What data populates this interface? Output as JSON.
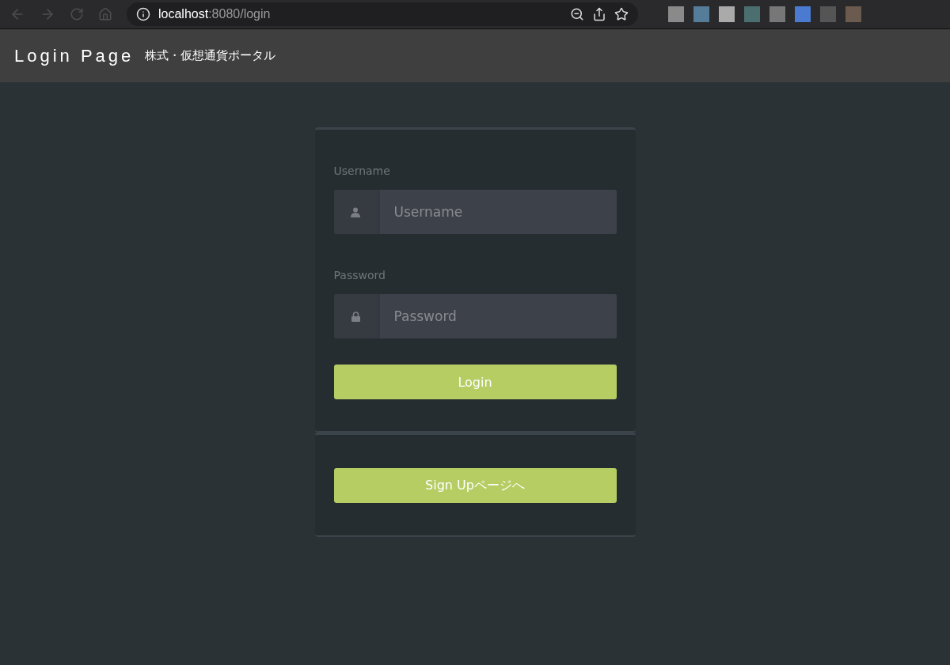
{
  "browser": {
    "url_host": "localhost",
    "url_path": ":8080/login"
  },
  "header": {
    "title": "Login Page",
    "subtitle": "株式・仮想通貨ポータル"
  },
  "login_form": {
    "fields": [
      {
        "label": "Username",
        "placeholder": "Username",
        "kind": "user"
      },
      {
        "label": "Password",
        "placeholder": "Password",
        "kind": "password"
      }
    ],
    "button": "Login"
  },
  "signup": {
    "button": "Sign Upページへ"
  }
}
